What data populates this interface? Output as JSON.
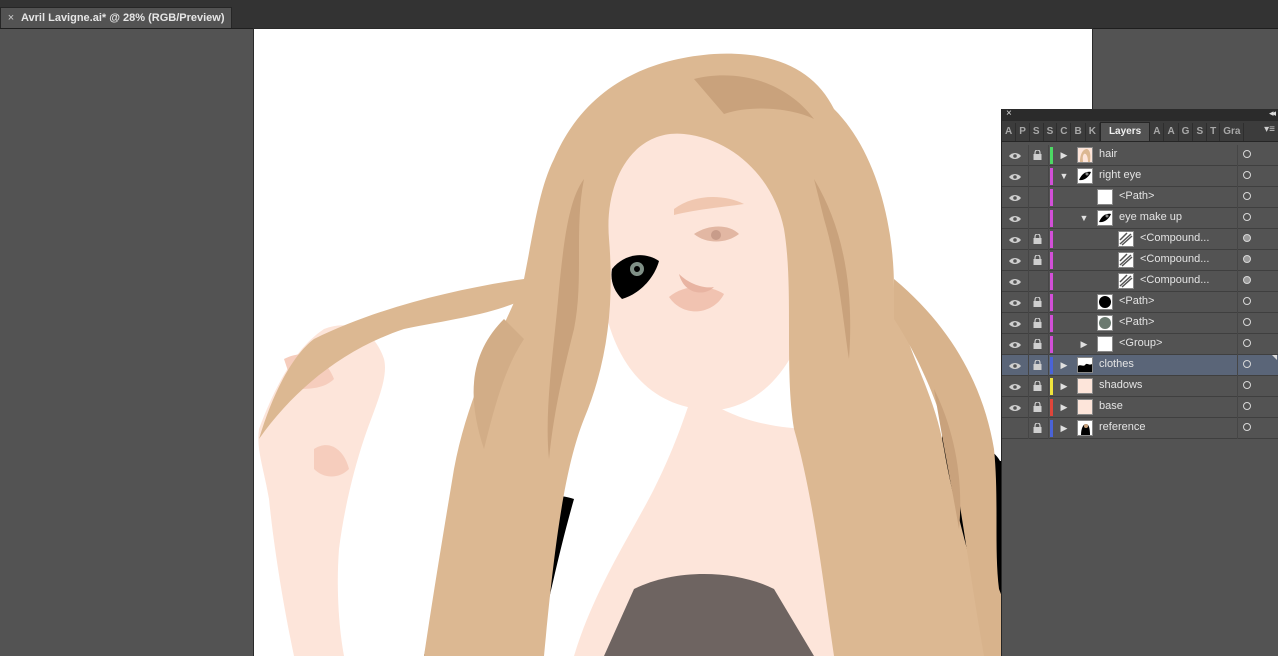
{
  "document": {
    "tab_title": "Avril Lavigne.ai* @ 28% (RGB/Preview)",
    "close_glyph": "×"
  },
  "panel": {
    "close_glyph": "×",
    "collapse_glyph": "◂◂",
    "menu_glyph": "▾≡",
    "tabs": [
      {
        "label": "A",
        "active": false
      },
      {
        "label": "P",
        "active": false
      },
      {
        "label": "S",
        "active": false
      },
      {
        "label": "S",
        "active": false
      },
      {
        "label": "C",
        "active": false
      },
      {
        "label": "B",
        "active": false
      },
      {
        "label": "K",
        "active": false
      },
      {
        "label": "Layers",
        "active": true
      },
      {
        "label": "A",
        "active": false
      },
      {
        "label": "A",
        "active": false
      },
      {
        "label": "G",
        "active": false
      },
      {
        "label": "S",
        "active": false
      },
      {
        "label": "T",
        "active": false
      },
      {
        "label": "Gra",
        "active": false
      }
    ],
    "layers": [
      {
        "name": "hair",
        "visible": true,
        "locked": true,
        "color": "#4cd964",
        "indent": 0,
        "arrow": "right",
        "thumb": "hair",
        "target": "empty",
        "selected": false
      },
      {
        "name": "right eye",
        "visible": true,
        "locked": false,
        "color": "#d24fd8",
        "indent": 0,
        "arrow": "down",
        "thumb": "eye",
        "target": "empty",
        "selected": false
      },
      {
        "name": "<Path>",
        "visible": true,
        "locked": false,
        "color": "#d24fd8",
        "indent": 1,
        "arrow": "none",
        "thumb": "blank",
        "target": "empty",
        "selected": false
      },
      {
        "name": "eye make up",
        "visible": true,
        "locked": false,
        "color": "#d24fd8",
        "indent": 1,
        "arrow": "down",
        "thumb": "eye",
        "target": "empty",
        "selected": false
      },
      {
        "name": "<Compound...",
        "visible": true,
        "locked": true,
        "color": "#d24fd8",
        "indent": 2,
        "arrow": "none",
        "thumb": "compound",
        "target": "filled",
        "selected": false
      },
      {
        "name": "<Compound...",
        "visible": true,
        "locked": true,
        "color": "#d24fd8",
        "indent": 2,
        "arrow": "none",
        "thumb": "compound",
        "target": "filled",
        "selected": false
      },
      {
        "name": "<Compound...",
        "visible": true,
        "locked": false,
        "color": "#d24fd8",
        "indent": 2,
        "arrow": "none",
        "thumb": "compound",
        "target": "filled",
        "selected": false
      },
      {
        "name": "<Path>",
        "visible": true,
        "locked": true,
        "color": "#d24fd8",
        "indent": 1,
        "arrow": "none",
        "thumb": "black-circle",
        "target": "empty",
        "selected": false
      },
      {
        "name": "<Path>",
        "visible": true,
        "locked": true,
        "color": "#d24fd8",
        "indent": 1,
        "arrow": "none",
        "thumb": "gray-circle",
        "target": "empty",
        "selected": false
      },
      {
        "name": "<Group>",
        "visible": true,
        "locked": true,
        "color": "#d24fd8",
        "indent": 1,
        "arrow": "right",
        "thumb": "blank",
        "target": "empty",
        "selected": false
      },
      {
        "name": "clothes",
        "visible": true,
        "locked": true,
        "color": "#4a63d8",
        "indent": 0,
        "arrow": "right",
        "thumb": "clothes",
        "target": "empty",
        "selected": true
      },
      {
        "name": "shadows",
        "visible": true,
        "locked": true,
        "color": "#f0e43c",
        "indent": 0,
        "arrow": "right",
        "thumb": "skin",
        "target": "empty",
        "selected": false
      },
      {
        "name": "base",
        "visible": true,
        "locked": true,
        "color": "#e0453a",
        "indent": 0,
        "arrow": "right",
        "thumb": "skin",
        "target": "empty",
        "selected": false
      },
      {
        "name": "reference",
        "visible": false,
        "locked": true,
        "color": "#4a63d8",
        "indent": 0,
        "arrow": "right",
        "thumb": "photo",
        "target": "empty",
        "selected": false
      }
    ]
  },
  "colors": {
    "hair": "#dcb892",
    "hair_dark": "#c9a27c",
    "skin": "#fde5da",
    "skin_shadow": "#f6cdbd",
    "clothes": "#000000",
    "shirt": "#6e6461"
  }
}
